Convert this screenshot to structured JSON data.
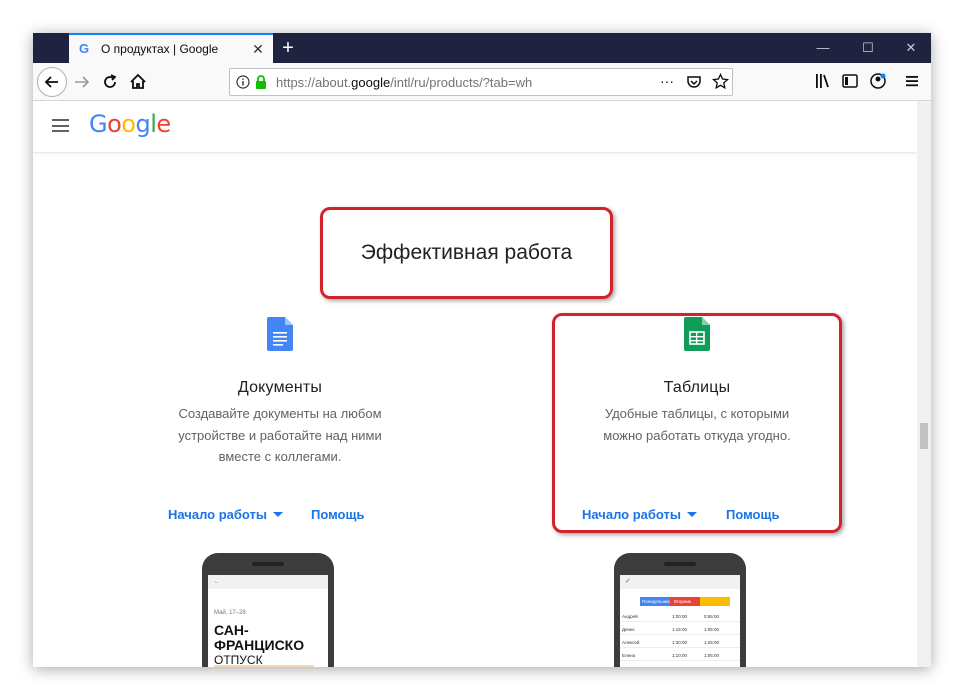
{
  "browser": {
    "tab_title": "О продуктах | Google",
    "favicon_letter": "G",
    "new_tab_symbol": "+",
    "close_symbol": "✕",
    "minimize_symbol": "—",
    "maximize_symbol": "☐",
    "window_close_symbol": "✕",
    "url_prefix": "https://about.",
    "url_domain": "google",
    "url_path": "/intl/ru/products/?tab=wh",
    "more_symbol": "···"
  },
  "site": {
    "logo": "Google",
    "logo_colors": [
      "#4285f4",
      "#ea4335",
      "#fbbc05",
      "#4285f4",
      "#34a853",
      "#ea4335"
    ]
  },
  "section": {
    "title": "Эффективная работа"
  },
  "cards": [
    {
      "title": "Документы",
      "description_lines": [
        "Создавайте документы на любом",
        "устройстве и работайте над ними",
        "вместе с коллегами."
      ],
      "start_label": "Начало работы",
      "help_label": "Помощь",
      "icon_color": "#4285f4"
    },
    {
      "title": "Таблицы",
      "description_lines": [
        "Удобные таблицы, с которыми",
        "можно работать откуда угодно."
      ],
      "start_label": "Начало работы",
      "help_label": "Помощь",
      "icon_color": "#0f9d58"
    }
  ],
  "phone_docs": {
    "date": "Май, 17–28",
    "headline_1": "САН-ФРАНЦИСКО",
    "headline_2": "ОТПУСК"
  },
  "phone_sheets": {
    "headers": [
      "Понедельник",
      "Вторник"
    ],
    "rows": [
      {
        "name": "Андрей",
        "a": "1:00:00",
        "b": "0:55:00"
      },
      {
        "name": "Денис",
        "a": "1:15:00",
        "b": "1:05:00"
      },
      {
        "name": "Алексей",
        "a": "1:30:00",
        "b": "1:25:00"
      },
      {
        "name": "Елена",
        "a": "1:10:00",
        "b": "1:05:00"
      },
      {
        "name": "Степан",
        "a": "1:00:00",
        "b": "0:55:00"
      }
    ]
  },
  "colors": {
    "highlight": "#d3222a",
    "link": "#1a73e8",
    "titlebar": "#202340"
  }
}
